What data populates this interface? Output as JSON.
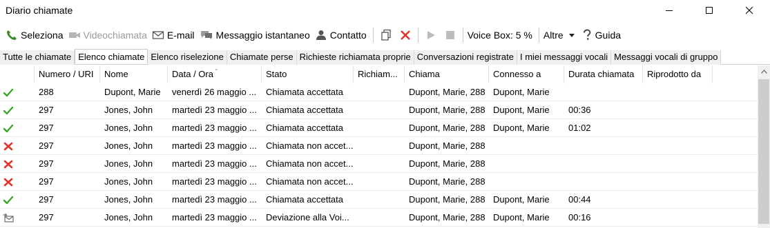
{
  "window": {
    "title": "Diario chiamate"
  },
  "toolbar": {
    "select_label": "Seleziona",
    "video_label": "Videochiamata",
    "email_label": "E-mail",
    "im_label": "Messaggio istantaneo",
    "contact_label": "Contatto",
    "voicebox_label": "Voice Box: 5 %",
    "more_label": "Altre",
    "help_label": "Guida"
  },
  "tabs": [
    {
      "label": "Tutte le chiamate"
    },
    {
      "label": "Elenco chiamate",
      "active": true
    },
    {
      "label": "Elenco riselezione"
    },
    {
      "label": "Chiamate perse"
    },
    {
      "label": "Richieste richiamata proprie"
    },
    {
      "label": "Conversazioni registrate"
    },
    {
      "label": "I miei messaggi vocali"
    },
    {
      "label": "Messaggi vocali di gruppo"
    }
  ],
  "table": {
    "columns": [
      "Numero / URI",
      "Nome",
      "Data / Ora",
      "Stato",
      "Richiam...",
      "Chiama",
      "Connesso a",
      "Durata chiamata",
      "Riprodotto da"
    ],
    "rows": [
      {
        "icon": "accepted-check-icon",
        "number": "288",
        "name": "Dupont, Marie",
        "date": "venerdì 26 maggio ...",
        "status": "Chiamata accettata",
        "callback": "",
        "caller": "Dupont, Marie, 288",
        "connected": "Dupont, Marie",
        "duration": "",
        "played": ""
      },
      {
        "icon": "accepted-check-icon",
        "number": "297",
        "name": "Jones, John",
        "date": "martedì 23 maggio ...",
        "status": "Chiamata accettata",
        "callback": "",
        "caller": "Dupont, Marie, 288",
        "connected": "Dupont, Marie",
        "duration": "00:36",
        "played": ""
      },
      {
        "icon": "accepted-check-icon",
        "number": "297",
        "name": "Jones, John",
        "date": "martedì 23 maggio ...",
        "status": "Chiamata accettata",
        "callback": "",
        "caller": "Dupont, Marie, 288",
        "connected": "Dupont, Marie",
        "duration": "01:02",
        "played": ""
      },
      {
        "icon": "missed-x-icon",
        "number": "297",
        "name": "Jones, John",
        "date": "martedì 23 maggio ...",
        "status": "Chiamata non accet...",
        "callback": "",
        "caller": "Dupont, Marie, 288",
        "connected": "",
        "duration": "",
        "played": ""
      },
      {
        "icon": "missed-x-icon",
        "number": "297",
        "name": "Jones, John",
        "date": "martedì 23 maggio ...",
        "status": "Chiamata non accet...",
        "callback": "",
        "caller": "Dupont, Marie, 288",
        "connected": "",
        "duration": "",
        "played": ""
      },
      {
        "icon": "missed-x-icon",
        "number": "297",
        "name": "Jones, John",
        "date": "martedì 23 maggio ...",
        "status": "Chiamata non accet...",
        "callback": "",
        "caller": "Dupont, Marie, 288",
        "connected": "",
        "duration": "",
        "played": ""
      },
      {
        "icon": "accepted-check-icon",
        "number": "297",
        "name": "Jones, John",
        "date": "martedì 23 maggio ...",
        "status": "Chiamata accettata",
        "callback": "",
        "caller": "Dupont, Marie, 288",
        "connected": "Dupont, Marie",
        "duration": "00:44",
        "played": ""
      },
      {
        "icon": "forwarded-mail-icon",
        "number": "297",
        "name": "Jones, John",
        "date": "martedì 23 maggio ...",
        "status": "Deviazione alla Voi...",
        "callback": "",
        "caller": "Dupont, Marie, 288",
        "connected": "Dupont, Marie",
        "duration": "00:16",
        "played": ""
      }
    ]
  },
  "colors": {
    "accepted": "#3aa629",
    "missed": "#e0352b",
    "forwarded": "#6b6b6b",
    "delete": "#e0352b"
  }
}
